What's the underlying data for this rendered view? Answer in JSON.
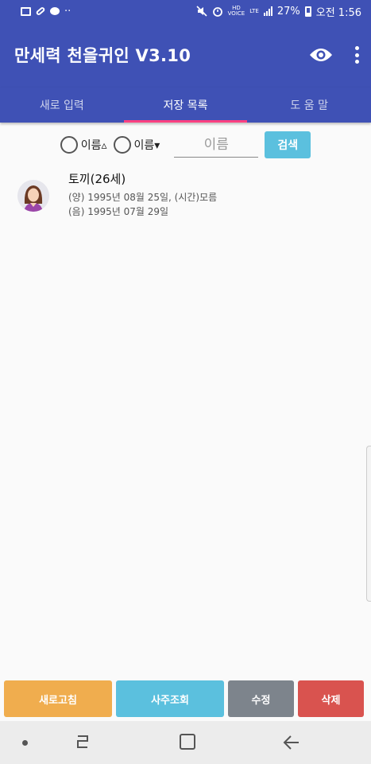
{
  "status_bar": {
    "battery": "27%",
    "time": "오전 1:56",
    "network": "LTE",
    "hd_label": "HD",
    "hd_sub": "VOICE"
  },
  "app_bar": {
    "title": "만세력 천을귀인 V3.10",
    "icons": [
      "eye-icon",
      "more-vert-icon"
    ]
  },
  "tabs": [
    {
      "label": "새로 입력",
      "active": false
    },
    {
      "label": "저장 목록",
      "active": true
    },
    {
      "label": "도 움 말",
      "active": false
    }
  ],
  "sort_options": [
    {
      "label": "이름▵",
      "selected": false
    },
    {
      "label": "이름▾",
      "selected": false
    }
  ],
  "search": {
    "placeholder": "이름",
    "value": "",
    "button_label": "검색"
  },
  "list_items": [
    {
      "title": "토끼(26세)",
      "solar": "(양) 1995년 08월 25일, (시간)모름",
      "lunar": "(음) 1995년 07월 29일",
      "avatar": "female-avatar-icon"
    }
  ],
  "buttons": {
    "refresh": "새로고침",
    "saju": "사주조회",
    "edit": "수정",
    "delete": "삭제"
  },
  "colors": {
    "primary": "#3f51b5",
    "accent": "#ff4081",
    "info": "#5bc0de",
    "warning": "#f0ad4e",
    "secondary": "#7d848c",
    "danger": "#d9534f"
  }
}
